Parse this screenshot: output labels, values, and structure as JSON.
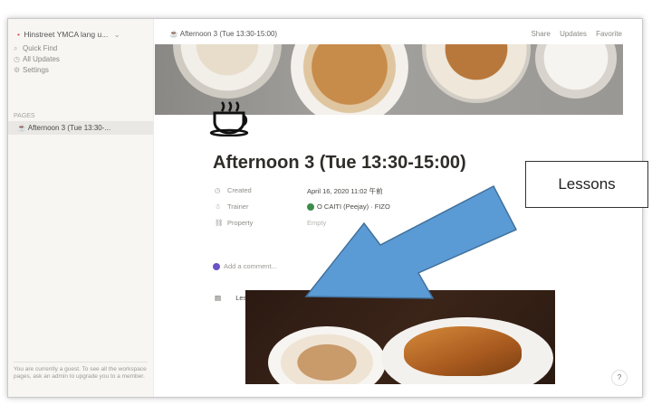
{
  "sidebar": {
    "workspace_name": "Hinstreet YMCA lang u...",
    "nav": [
      {
        "label": "Quick Find",
        "icon": "search-icon"
      },
      {
        "label": "All Updates",
        "icon": "clock-icon"
      },
      {
        "label": "Settings",
        "icon": "gear-icon"
      }
    ],
    "section_label": "PAGES",
    "page_item": "Afternoon 3 (Tue 13:30-...",
    "note": "You are currently a guest. To see all the workspace pages, ask an admin to upgrade you to a member."
  },
  "topbar": {
    "breadcrumb": "Afternoon 3 (Tue 13:30-15:00)",
    "share": "Share",
    "updates": "Updates",
    "favorite": "Favorite"
  },
  "page": {
    "title": "Afternoon 3 (Tue 13:30-15:00)",
    "properties": [
      {
        "name": "Created",
        "value": "April 16, 2020 11:02 午前",
        "icon": "clock-icon"
      },
      {
        "name": "Trainer",
        "value": "O CAITI (Peejay) · FIZO",
        "icon": "person-icon"
      },
      {
        "name": "Property",
        "value": "Empty",
        "icon": "link-icon"
      }
    ],
    "add_comment": "Add a comment...",
    "block_label": "Lessons",
    "help": "?"
  },
  "annotation": {
    "callout": "Lessons",
    "arrow_color": "#5b9bd5"
  }
}
